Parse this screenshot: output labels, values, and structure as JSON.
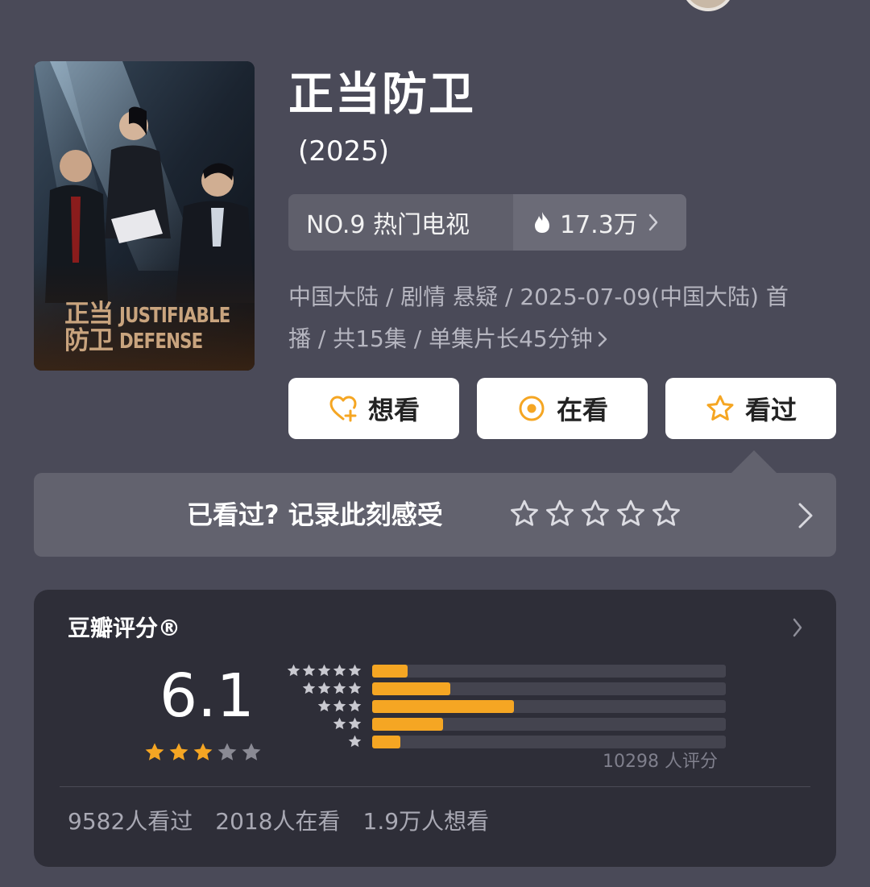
{
  "movie": {
    "title": "正当防卫",
    "year": "(2025)",
    "poster": {
      "title_cn_line1": "正当",
      "title_cn_line2": "防卫",
      "title_en_line1": "JUSTIFIABLE",
      "title_en_line2": "DEFENSE"
    }
  },
  "ranking": {
    "label": "NO.9 热门电视",
    "heat": "17.3万",
    "icon": "flame-icon"
  },
  "meta": {
    "line1": "中国大陆 / 剧情 悬疑 / 2025-07-09(中国大陆) 首",
    "line2": "播 / 共15集 / 单集片长45分钟"
  },
  "actions": {
    "want": "想看",
    "watching": "在看",
    "watched": "看过"
  },
  "feeling": {
    "prompt": "已看过? 记录此刻感受",
    "star_count": 5
  },
  "rating": {
    "label": "豆瓣评分®",
    "score": "6.1",
    "stars": 3,
    "distribution": [
      {
        "stars": 5,
        "fraction": 0.1
      },
      {
        "stars": 4,
        "fraction": 0.22
      },
      {
        "stars": 3,
        "fraction": 0.4
      },
      {
        "stars": 2,
        "fraction": 0.2
      },
      {
        "stars": 1,
        "fraction": 0.08
      }
    ],
    "count": "10298 人评分",
    "watched": "9582人看过",
    "watching": "2018人在看",
    "want": "1.9万人想看"
  },
  "colors": {
    "background": "#4a4a58",
    "card": "#2e2e38",
    "accent": "#f5a623",
    "button_bg": "#ffffff"
  }
}
